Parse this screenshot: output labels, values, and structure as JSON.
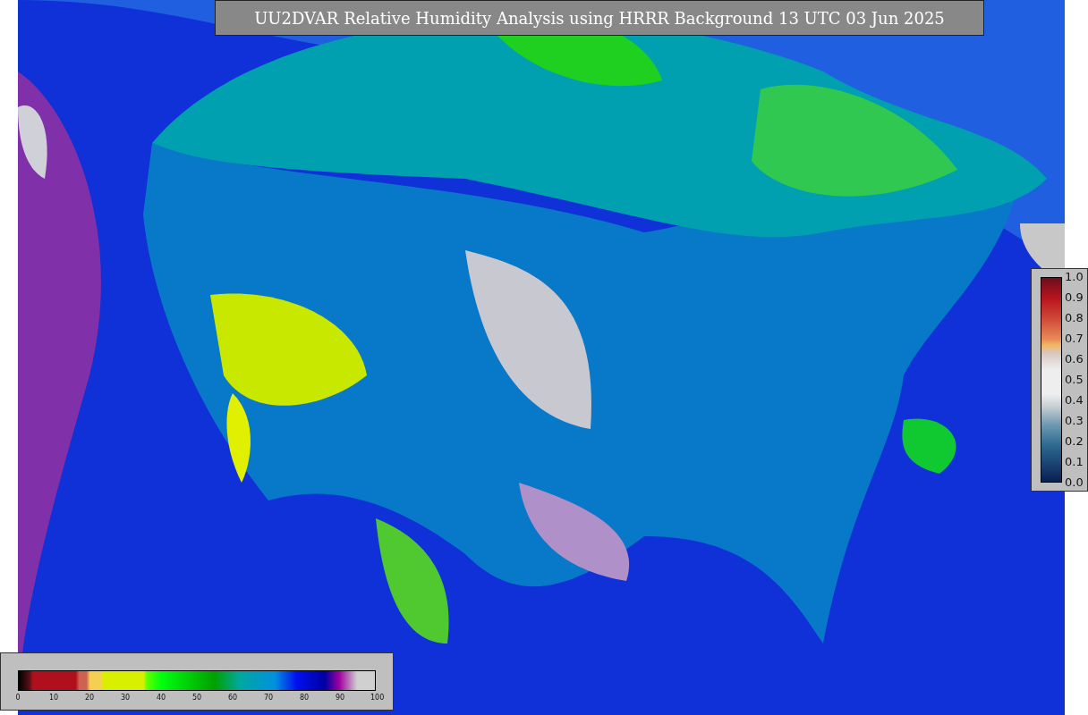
{
  "title": "UU2DVAR Relative Humidity Analysis using HRRR Background 13 UTC 03 Jun 2025",
  "humidity_colorbar": {
    "ticks": [
      "0",
      "10",
      "20",
      "30",
      "40",
      "50",
      "60",
      "70",
      "80",
      "90",
      "100"
    ]
  },
  "observation_colorbar": {
    "ticks": [
      "1.0",
      "0.9",
      "0.8",
      "0.7",
      "0.6",
      "0.5",
      "0.4",
      "0.3",
      "0.2",
      "0.1",
      "0.0"
    ]
  }
}
